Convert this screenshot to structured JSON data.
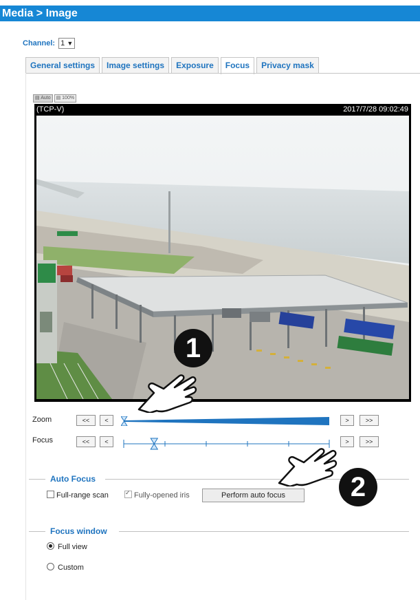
{
  "title": "Media > Image",
  "channel": {
    "label": "Channel:",
    "value": "1"
  },
  "tabs": [
    {
      "label": "General settings"
    },
    {
      "label": "Image settings"
    },
    {
      "label": "Exposure"
    },
    {
      "label": "Focus"
    },
    {
      "label": "Privacy mask"
    }
  ],
  "active_tab": "Focus",
  "view_buttons": {
    "auto": "Auto",
    "full": "100%"
  },
  "video": {
    "stream": "(TCP-V)",
    "timestamp": "2017/7/28 09:02:49"
  },
  "zoom": {
    "label": "Zoom",
    "btn_far_left": "<<",
    "btn_left": "<",
    "btn_right": ">",
    "btn_far_right": ">>",
    "position": 0.0
  },
  "focus": {
    "label": "Focus",
    "btn_far_left": "<<",
    "btn_left": "<",
    "btn_right": ">",
    "btn_far_right": ">>",
    "position": 0.15
  },
  "auto_focus": {
    "legend": "Auto Focus",
    "full_range_scan": {
      "label": "Full-range scan",
      "checked": false
    },
    "fully_opened_iris": {
      "label": "Fully-opened iris",
      "checked": true
    },
    "perform_button": "Perform auto focus"
  },
  "focus_window": {
    "legend": "Focus window",
    "options": [
      {
        "label": "Full view",
        "selected": true
      },
      {
        "label": "Custom",
        "selected": false
      }
    ]
  },
  "callouts": [
    "1",
    "2"
  ],
  "colors": {
    "accent": "#1687d5",
    "link": "#1f74bf"
  }
}
